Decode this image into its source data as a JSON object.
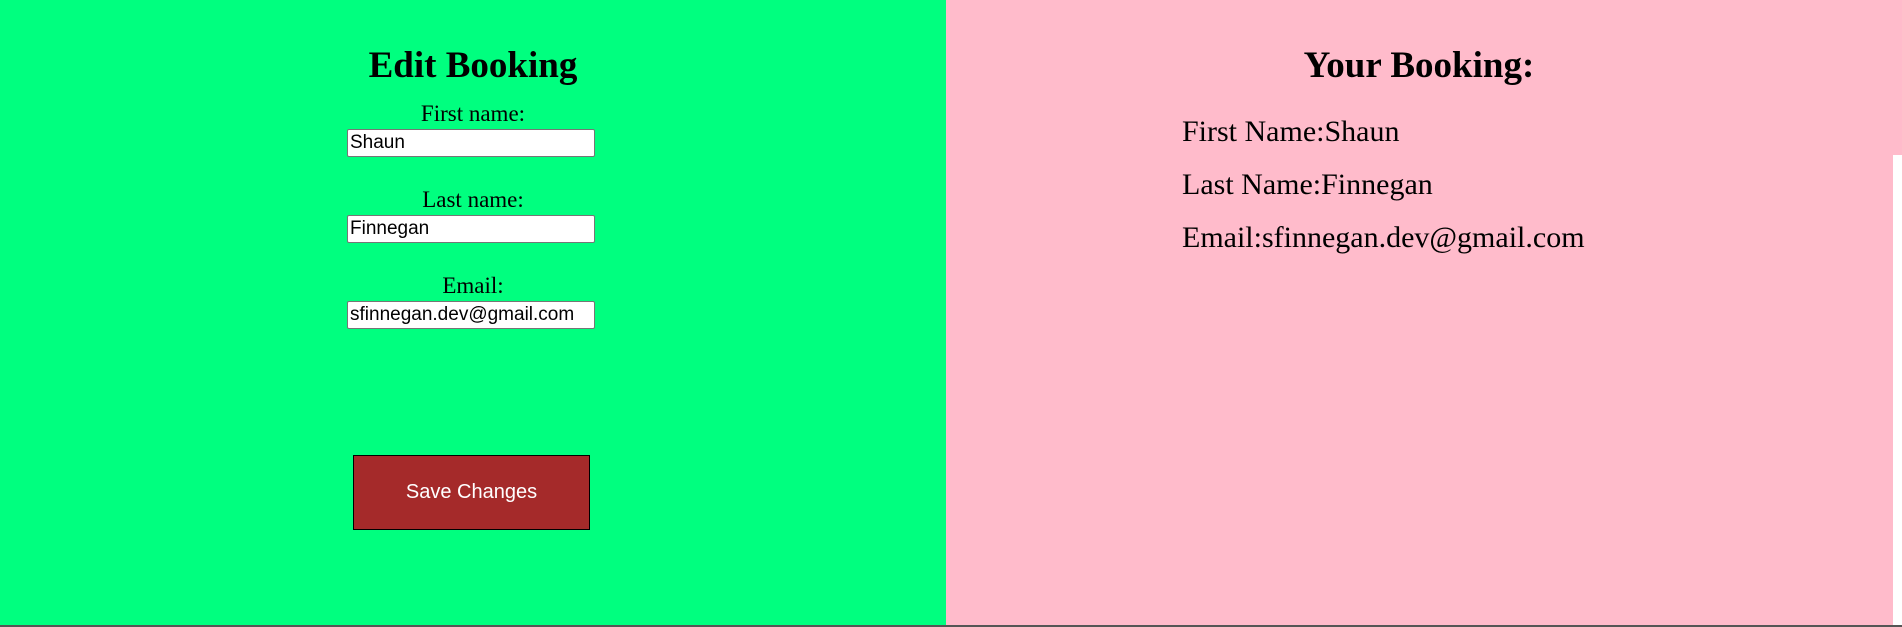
{
  "edit_form": {
    "title": "Edit Booking",
    "first_name": {
      "label": "First name:",
      "value": "Shaun"
    },
    "last_name": {
      "label": "Last name:",
      "value": "Finnegan"
    },
    "email": {
      "label": "Email:",
      "value": "sfinnegan.dev@gmail.com"
    },
    "save_label": "Save Changes"
  },
  "summary": {
    "title": "Your Booking:",
    "first_name_label": "First Name:",
    "first_name_value": "Shaun",
    "last_name_label": "Last Name:",
    "last_name_value": "Finnegan",
    "email_label": "Email:",
    "email_value": "sfinnegan.dev@gmail.com"
  },
  "colors": {
    "left_background": "#00ff7f",
    "right_background": "#ffbbcb",
    "button_background": "#a52a2a",
    "button_text": "#ffffff"
  }
}
